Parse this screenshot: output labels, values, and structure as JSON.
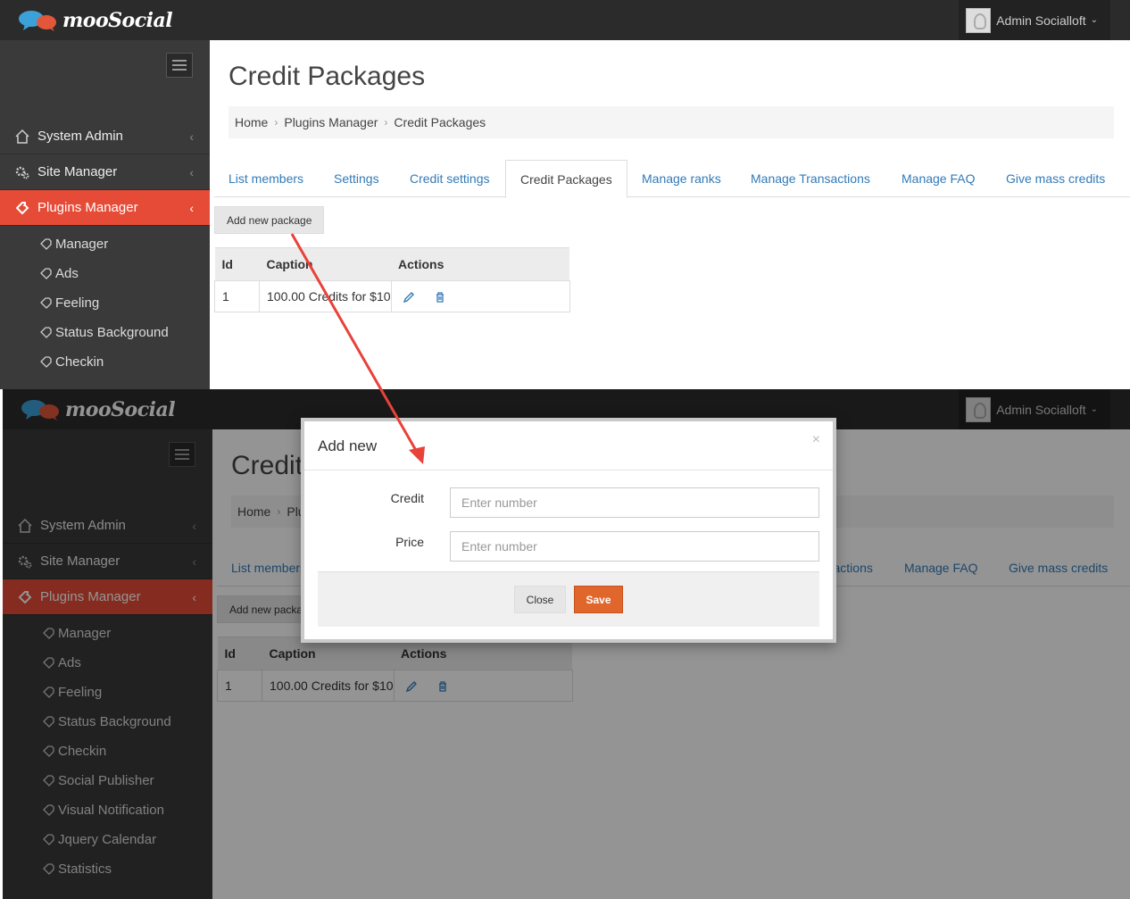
{
  "brand": {
    "logo_text": "mooSocial"
  },
  "user": {
    "name": "Admin Socialloft"
  },
  "sidebar": {
    "menu": [
      {
        "label": "System Admin",
        "icon": "home-icon"
      },
      {
        "label": "Site Manager",
        "icon": "gears-icon"
      },
      {
        "label": "Plugins Manager",
        "icon": "puzzle-icon",
        "active": true
      }
    ],
    "sub_items_shot1": [
      "Manager",
      "Ads",
      "Feeling",
      "Status Background",
      "Checkin"
    ],
    "sub_items_shot2": [
      "Manager",
      "Ads",
      "Feeling",
      "Status Background",
      "Checkin",
      "Social Publisher",
      "Visual Notification",
      "Jquery Calendar",
      "Statistics"
    ]
  },
  "page": {
    "title": "Credit Packages",
    "breadcrumb": [
      "Home",
      "Plugins Manager",
      "Credit Packages"
    ]
  },
  "tabs": [
    "List members",
    "Settings",
    "Credit settings",
    "Credit Packages",
    "Manage ranks",
    "Manage Transactions",
    "Manage FAQ",
    "Give mass credits"
  ],
  "toolbar": {
    "add_label": "Add new package"
  },
  "table": {
    "headers": [
      "Id",
      "Caption",
      "Actions"
    ],
    "rows": [
      {
        "id": "1",
        "caption": "100.00 Credits for $10"
      }
    ]
  },
  "modal": {
    "title": "Add new",
    "close_symbol": "×",
    "fields": [
      {
        "label": "Credit",
        "placeholder": "Enter number"
      },
      {
        "label": "Price",
        "placeholder": "Enter number"
      }
    ],
    "close_label": "Close",
    "save_label": "Save"
  },
  "colors": {
    "accent": "#e54b36",
    "save": "#e0662b",
    "link": "#337ab7"
  }
}
